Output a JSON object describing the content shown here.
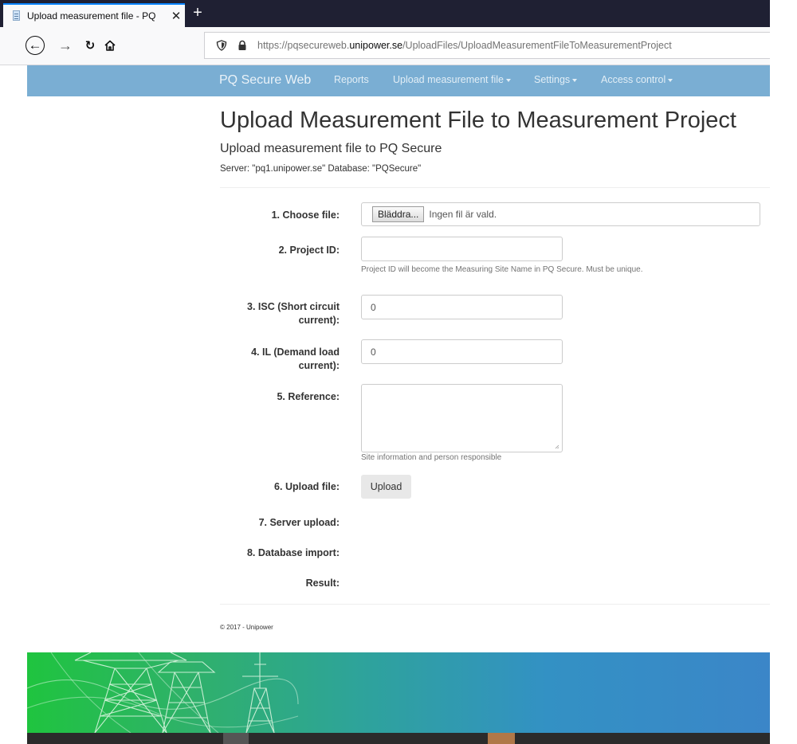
{
  "browser": {
    "tab_title": "Upload measurement file - PQ",
    "tab_close": "✕",
    "new_tab": "+",
    "url_prefix": "https://pqsecureweb.",
    "url_domain": "unipower.se",
    "url_path": "/UploadFiles/UploadMeasurementFileToMeasurementProject"
  },
  "sitenav": {
    "brand": "PQ Secure Web",
    "items": [
      {
        "label": "Reports",
        "dropdown": false
      },
      {
        "label": "Upload measurement file",
        "dropdown": true
      },
      {
        "label": "Settings",
        "dropdown": true
      },
      {
        "label": "Access control",
        "dropdown": true
      }
    ]
  },
  "page": {
    "title": "Upload Measurement File to Measurement Project",
    "subtitle": "Upload measurement file to PQ Secure",
    "server_info": "Server: \"pq1.unipower.se\" Database: \"PQSecure\""
  },
  "form": {
    "choose_file_label": "1. Choose file:",
    "browse_button": "Bläddra...",
    "file_status": "Ingen fil är vald.",
    "project_id_label": "2. Project ID:",
    "project_id_value": "",
    "project_id_help": "Project ID will become the Measuring Site Name in PQ Secure. Must be unique.",
    "isc_label": "3. ISC (Short circuit current):",
    "isc_value": "0",
    "il_label": "4. IL (Demand load current):",
    "il_value": "0",
    "reference_label": "5. Reference:",
    "reference_value": "",
    "reference_help": "Site information and person responsible",
    "upload_label": "6. Upload file:",
    "upload_button": "Upload",
    "server_upload_label": "7. Server upload:",
    "db_import_label": "8. Database import:",
    "result_label": "Result:"
  },
  "footer": {
    "copyright": "© 2017 - Unipower"
  },
  "colors": {
    "nav_bg": "#7aaed3",
    "banner_start": "#1fc43f",
    "banner_end": "#3b86c8",
    "tab_accent": "#0a84ff"
  },
  "icons": [
    "favicon-page-icon",
    "back-arrow-icon",
    "forward-arrow-icon",
    "reload-icon",
    "home-icon",
    "shield-icon",
    "lock-icon",
    "resize-grip-icon",
    "power-tower-illustration"
  ]
}
